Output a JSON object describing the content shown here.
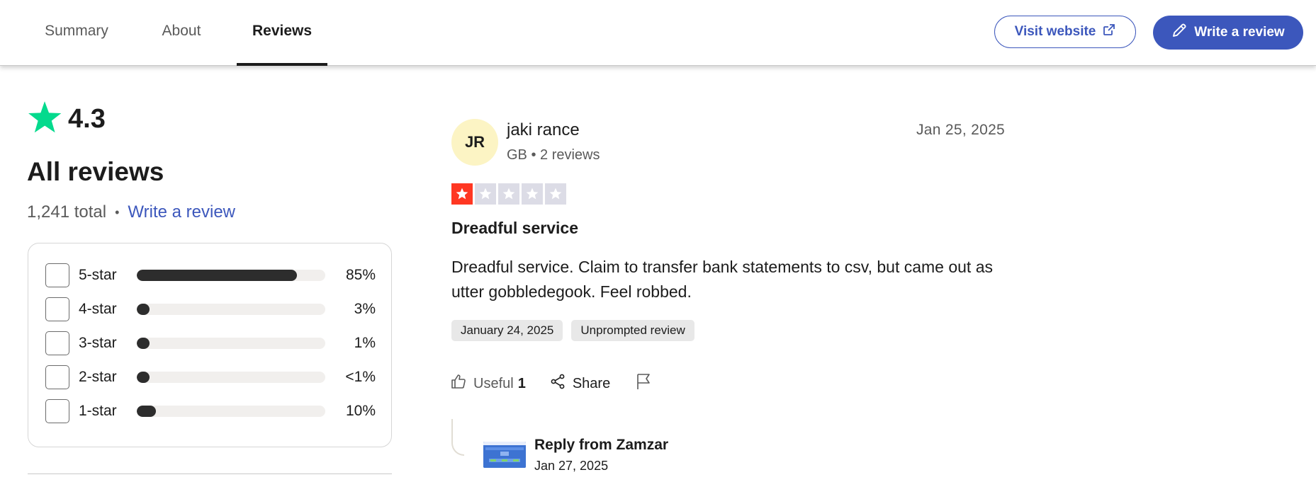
{
  "nav": {
    "tabs": [
      {
        "label": "Summary"
      },
      {
        "label": "About"
      },
      {
        "label": "Reviews",
        "active": true
      }
    ],
    "visit_website": "Visit website",
    "write_review": "Write a review"
  },
  "summary": {
    "rating": "4.3",
    "heading": "All reviews",
    "total": "1,241 total",
    "write_review_link": "Write a review",
    "distribution": [
      {
        "label": "5-star",
        "percent_text": "85%",
        "value": 85
      },
      {
        "label": "4-star",
        "percent_text": "3%",
        "value": 3
      },
      {
        "label": "3-star",
        "percent_text": "1%",
        "value": 1
      },
      {
        "label": "2-star",
        "percent_text": "<1%",
        "value": 0.5
      },
      {
        "label": "1-star",
        "percent_text": "10%",
        "value": 10
      }
    ]
  },
  "review": {
    "avatar_initials": "JR",
    "reviewer_name": "jaki rance",
    "reviewer_meta": "GB • 2 reviews",
    "date": "Jan 25, 2025",
    "stars": 1,
    "title": "Dreadful service",
    "body": "Dreadful service. Claim to transfer bank statements to csv, but came out as utter gobbledegook. Feel robbed.",
    "tags": [
      "January 24, 2025",
      "Unprompted review"
    ],
    "useful_label": "Useful",
    "useful_count": "1",
    "share_label": "Share",
    "reply": {
      "from": "Reply from Zamzar",
      "date": "Jan 27, 2025"
    }
  },
  "colors": {
    "accent": "#3c57bc",
    "star_green": "#04da8d",
    "star_red": "#ff3722",
    "star_empty": "#dcdce6",
    "avatar_bg": "#fcf4c4",
    "bar_fill": "#2d2d2d",
    "bar_track": "#f1efed"
  }
}
